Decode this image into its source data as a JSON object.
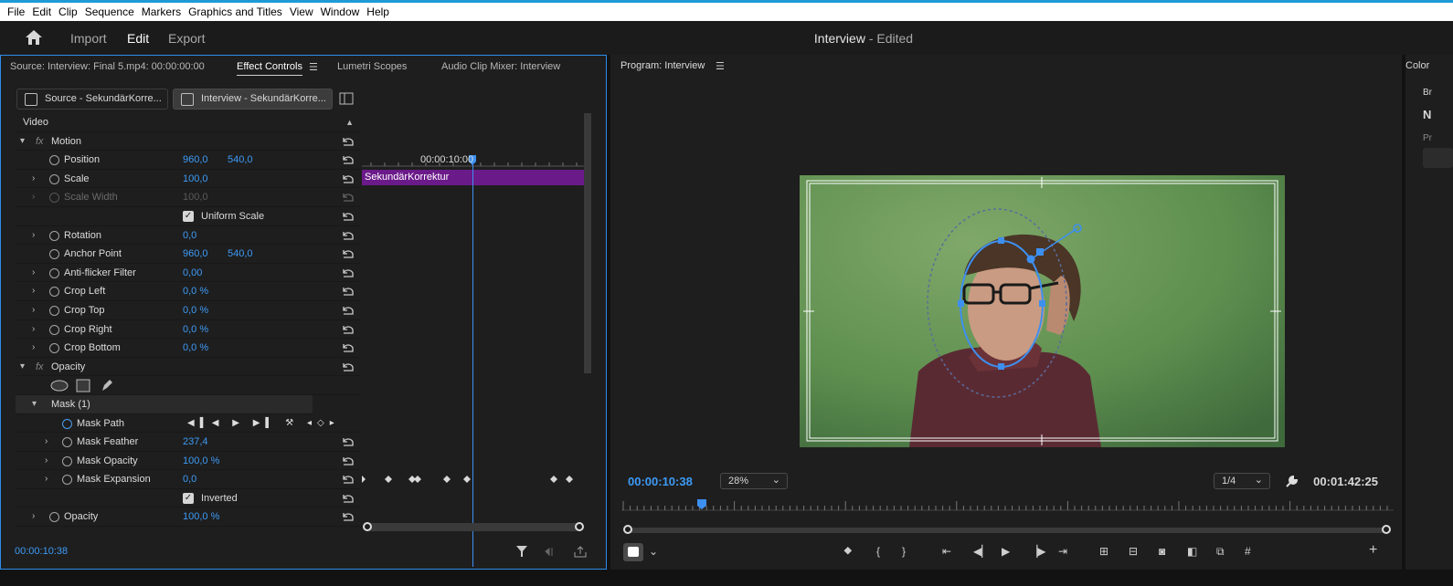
{
  "menu": [
    "File",
    "Edit",
    "Clip",
    "Sequence",
    "Markers",
    "Graphics and Titles",
    "View",
    "Window",
    "Help"
  ],
  "header": {
    "workspaces": [
      "Import",
      "Edit",
      "Export"
    ],
    "active_workspace": "Edit",
    "project_name": "Interview",
    "project_status": " - Edited"
  },
  "effect_controls": {
    "tabs": [
      "Source: Interview: Final 5.mp4: 00:00:00:00",
      "Effect Controls",
      "Lumetri Scopes",
      "Audio Clip Mixer: Interview"
    ],
    "source_clip": "Source - SekundärKorre...",
    "sequence_clip": "Interview - SekundärKorre...",
    "section": "Video",
    "ruler_time": "00:00:10:00",
    "clip_name": "SekundärKorrektur",
    "current_time": "00:00:10:38",
    "motion_label": "Motion",
    "opacity_label": "Opacity",
    "mask_label": "Mask (1)",
    "props": {
      "position": {
        "name": "Position",
        "v1": "960,0",
        "v2": "540,0"
      },
      "scale": {
        "name": "Scale",
        "v1": "100,0"
      },
      "scale_width": {
        "name": "Scale Width",
        "v1": "100,0"
      },
      "uniform_scale": "Uniform Scale",
      "rotation": {
        "name": "Rotation",
        "v1": "0,0"
      },
      "anchor": {
        "name": "Anchor Point",
        "v1": "960,0",
        "v2": "540,0"
      },
      "antiflicker": {
        "name": "Anti-flicker Filter",
        "v1": "0,00"
      },
      "crop_left": {
        "name": "Crop Left",
        "v1": "0,0 %"
      },
      "crop_top": {
        "name": "Crop Top",
        "v1": "0,0 %"
      },
      "crop_right": {
        "name": "Crop Right",
        "v1": "0,0 %"
      },
      "crop_bottom": {
        "name": "Crop Bottom",
        "v1": "0,0 %"
      },
      "mask_path": "Mask Path",
      "mask_feather": {
        "name": "Mask Feather",
        "v1": "237,4"
      },
      "mask_opacity": {
        "name": "Mask Opacity",
        "v1": "100,0 %"
      },
      "mask_expansion": {
        "name": "Mask Expansion",
        "v1": "0,0"
      },
      "inverted": "Inverted",
      "opacity": {
        "name": "Opacity",
        "v1": "100,0 %"
      }
    }
  },
  "program": {
    "title": "Program: Interview",
    "current_time": "00:00:10:38",
    "zoom": "28%",
    "resolution": "1/4",
    "duration": "00:01:42:25"
  },
  "right_panel": {
    "title": "Color",
    "lines": [
      "Br",
      "N",
      "Pr"
    ]
  },
  "colors": {
    "accent_blue": "#3d9bf7",
    "clip_purple": "#6b1a8a",
    "panel_border": "#2d8ceb"
  }
}
